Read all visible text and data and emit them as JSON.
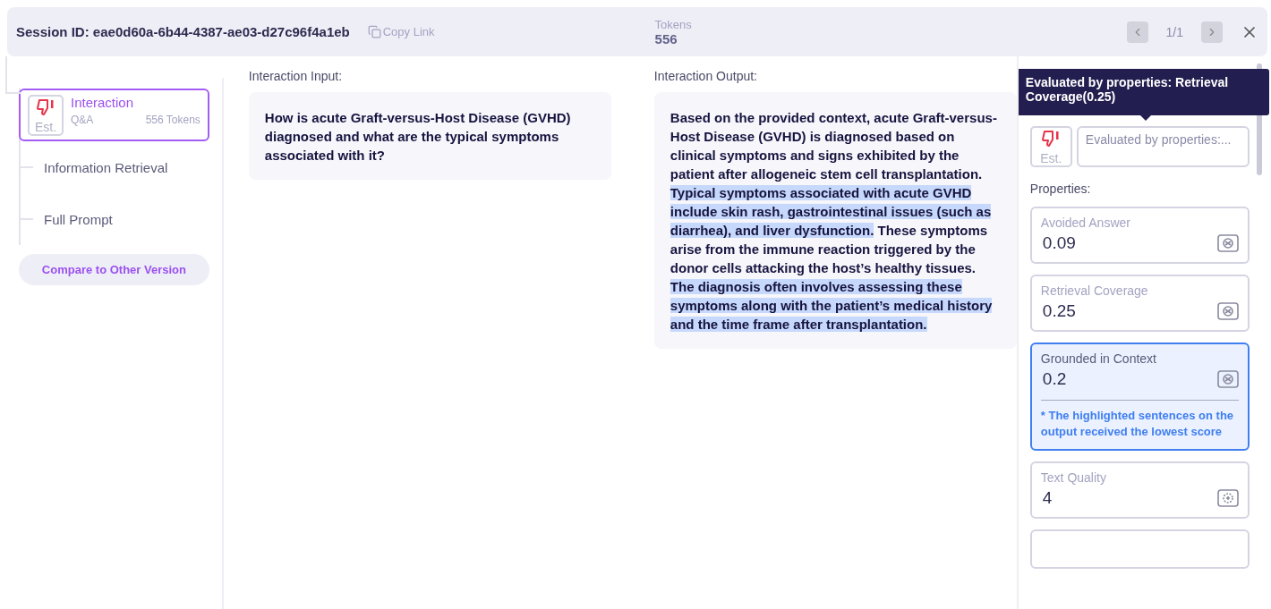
{
  "header": {
    "session_label": "Session ID: eae0d60a-6b44-4387-ae03-d27c96f4a1eb",
    "copy_link": "Copy Link",
    "tokens_label": "Tokens",
    "tokens_value": "556",
    "pager": "1/1"
  },
  "sidebar": {
    "items": [
      {
        "kind": "interaction",
        "title": "Interaction",
        "subtitle": "Q&A",
        "tokens": "556 Tokens",
        "badge": "Est.",
        "selected": true
      },
      {
        "kind": "step",
        "title": "Information Retrieval",
        "selected": false
      },
      {
        "kind": "step",
        "title": "Full Prompt",
        "selected": false
      }
    ],
    "compare_button": "Compare to Other Version"
  },
  "input": {
    "label": "Interaction Input:",
    "text": "How is acute Graft-versus-Host Disease (GVHD) diagnosed and what are the typical symptoms associated with it?"
  },
  "output": {
    "label": "Interaction Output:",
    "segments": [
      {
        "text": "Based on the provided context, acute Graft-versus-Host Disease (GVHD) is diagnosed based on clinical symptoms and signs exhibited by the patient after allogeneic stem cell transplantation. ",
        "highlighted": false
      },
      {
        "text": "Typical symptoms associated with acute GVHD include skin rash, gastrointestinal issues (such as diarrhea), and liver dysfunction.",
        "highlighted": true
      },
      {
        "text": " These symptoms arise from the immune reaction triggered by the donor cells attacking the host’s healthy tissues. ",
        "highlighted": false
      },
      {
        "text": "The diagnosis often involves assessing these symptoms along with the patient’s medical history and the time frame after transplantation.",
        "highlighted": true
      }
    ]
  },
  "details": {
    "annotation_badge": "Est.",
    "annotation_text": "Evaluated by properties:...",
    "tooltip": "Evaluated by properties: Retrieval Coverage(0.25)",
    "properties_label": "Properties:",
    "properties": [
      {
        "kind": "auto",
        "name": "Avoided Answer",
        "value": "0.09",
        "selected": false
      },
      {
        "kind": "auto",
        "name": "Retrieval Coverage",
        "value": "0.25",
        "selected": false
      },
      {
        "kind": "auto",
        "name": "Grounded in Context",
        "value": "0.2",
        "selected": true,
        "note": "* The highlighted sentences on the output received the lowest score"
      },
      {
        "kind": "llm",
        "name": "Text Quality",
        "value": "4",
        "selected": false
      }
    ]
  }
}
